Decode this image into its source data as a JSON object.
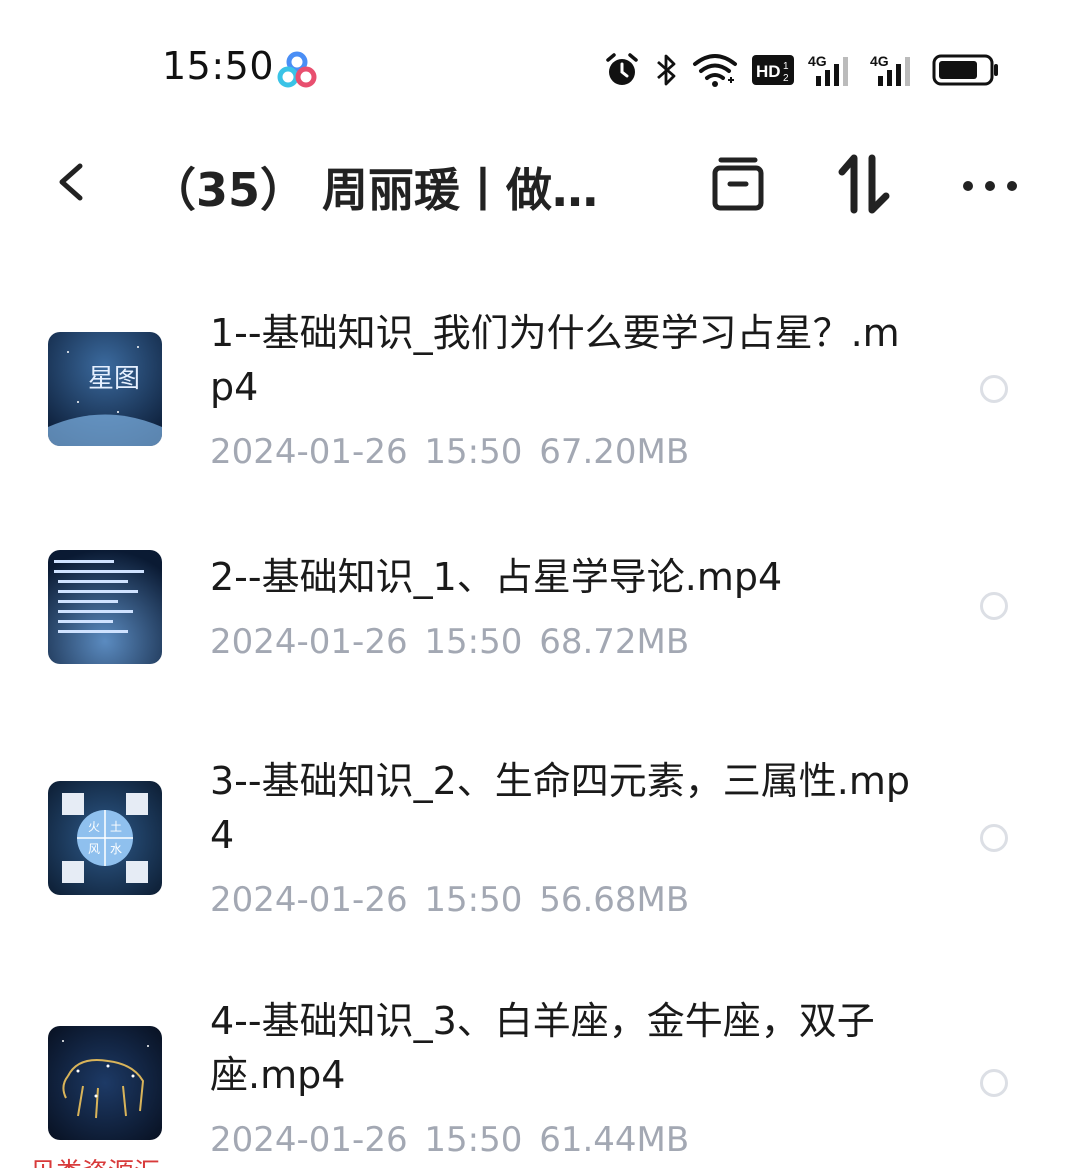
{
  "status_bar": {
    "time": "15:50",
    "icons": [
      "app-logo-icon",
      "alarm-icon",
      "bluetooth-icon",
      "wifi-icon",
      "hd-icon",
      "signal-4g-icon",
      "signal-4g-icon",
      "battery-icon"
    ],
    "hd_label": "HD",
    "network_label": "4G",
    "battery_level": 0.8
  },
  "header": {
    "title": "（35） 周丽瑗丨做…"
  },
  "files": [
    {
      "name": "1--基础知识_我们为什么要学习占星？.mp4",
      "date": "2024-01-26",
      "time": "15:50",
      "size": "67.20MB"
    },
    {
      "name": "2--基础知识_1、占星学导论.mp4",
      "date": "2024-01-26",
      "time": "15:50",
      "size": "68.72MB"
    },
    {
      "name": "3--基础知识_2、生命四元素，三属性.mp4",
      "date": "2024-01-26",
      "time": "15:50",
      "size": "56.68MB"
    },
    {
      "name": "4--基础知识_3、白羊座，金牛座，双子座.mp4",
      "date": "2024-01-26",
      "time": "15:50",
      "size": "61.44MB"
    }
  ],
  "thumbnails": {
    "thumb1_text": "星图",
    "thumb3_labels": [
      "火",
      "土",
      "风",
      "水"
    ]
  },
  "watermark": "贝类资源汇",
  "colors": {
    "meta_text": "#a3a8b3",
    "radio_border": "#dcdfe5",
    "thumb_bg": "#0f2a4d"
  }
}
